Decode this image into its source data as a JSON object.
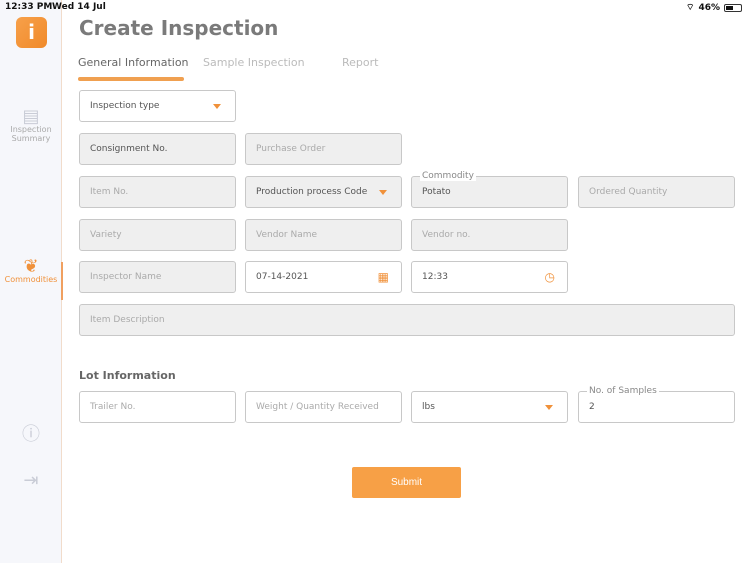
{
  "status": {
    "time": "12:33 PM",
    "date": "Wed 14 Jul",
    "battery": "46%",
    "battery_level": 46
  },
  "sidebar": {
    "items": [
      {
        "label": "Inspection Summary",
        "icon": "document-icon"
      },
      {
        "label": "Commodities",
        "icon": "fruits-icon",
        "active": true
      },
      {
        "icon": "info-icon"
      },
      {
        "icon": "logout-icon"
      }
    ]
  },
  "page": {
    "title": "Create Inspection"
  },
  "tabs": [
    {
      "label": "General Information",
      "active": true
    },
    {
      "label": "Sample Inspection"
    },
    {
      "label": "Report"
    }
  ],
  "form": {
    "inspection_type": "Inspection type",
    "consignment": "Consignment No.",
    "purchase_order": "Purchase Order",
    "item_no": "Item No.",
    "production_code": "Production process Code",
    "commodity_label": "Commodity",
    "commodity_value": "Potato",
    "ordered_quantity": "Ordered Quantity",
    "variety": "Variety",
    "vendor_name": "Vendor Name",
    "vendor_no": "Vendor no.",
    "inspector_name": "Inspector Name",
    "date": "07-14-2021",
    "time": "12:33",
    "item_description": "Item Description"
  },
  "lot": {
    "title": "Lot Information",
    "trailer": "Trailer No.",
    "weight": "Weight / Quantity Received",
    "unit": "lbs",
    "samples_label": "No. of Samples",
    "samples_value": "2"
  },
  "submit": "Submit",
  "colors": {
    "accent": "#f7a046"
  }
}
